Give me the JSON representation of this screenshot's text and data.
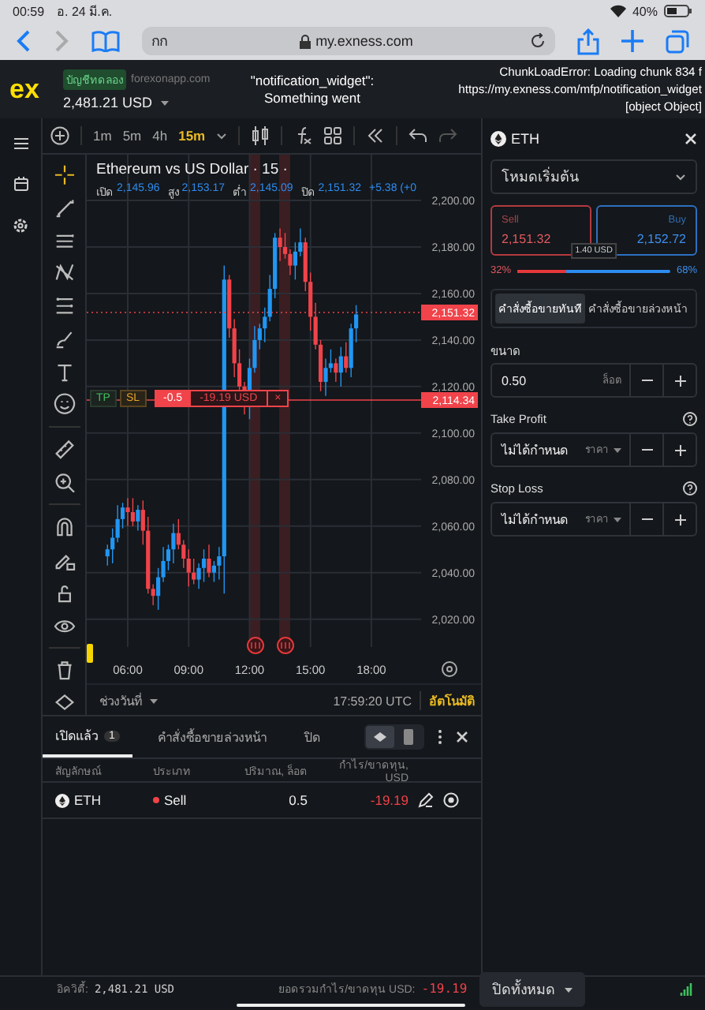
{
  "device_status": {
    "time": "00:59",
    "date": "อ. 24 มี.ค.",
    "battery": "40%"
  },
  "browser": {
    "text_size_button": "กก",
    "url": "my.exness.com"
  },
  "app_header": {
    "logo": "ex",
    "account_badge": "บัญชีทดลอง",
    "site": "forexonapp.com",
    "balance": "2,481.21 USD",
    "error_messages": [
      {
        "lines": [
          "\"notification_widget\":",
          "Something went"
        ]
      },
      {
        "lines": [
          "ChunkLoadError: Loading chunk 834 f",
          "https://my.exness.com/mfp/notification_widget",
          "[object Object]"
        ]
      }
    ]
  },
  "chart_toolbar": {
    "timeframes": [
      {
        "label": "1m",
        "selected": false
      },
      {
        "label": "5m",
        "selected": false
      },
      {
        "label": "4h",
        "selected": false
      },
      {
        "label": "15m",
        "selected": true
      }
    ]
  },
  "chart": {
    "title": "Ethereum vs US Dollar · 15 ·",
    "ohlc": [
      {
        "label": "เปิด",
        "value": "2,145.96"
      },
      {
        "label": "สูง",
        "value": "2,153.17"
      },
      {
        "label": "ต่ำ",
        "value": "2,145.09"
      },
      {
        "label": "ปิด",
        "value": "2,151.32"
      }
    ],
    "change": "+5.38 (+0",
    "chart_data": {
      "type": "candlestick",
      "xlim": [
        3.98,
        20.45
      ],
      "ylim": [
        2008,
        2219.7
      ],
      "grid": true,
      "x": [
        5,
        5.25,
        5.5,
        5.75,
        6,
        6.25,
        6.5,
        6.75,
        7,
        7.25,
        7.5,
        7.75,
        8,
        8.25,
        8.5,
        8.75,
        9,
        9.25,
        9.5,
        9.75,
        10,
        10.25,
        10.5,
        10.75,
        11,
        11.25,
        11.5,
        11.75,
        12,
        12.25,
        12.5,
        12.75,
        13,
        13.25,
        13.5,
        13.75,
        14,
        14.25,
        14.5,
        14.75,
        15,
        15.25,
        15.5,
        15.75,
        16,
        16.25,
        16.5,
        16.75,
        17,
        17.25
      ],
      "xticks": [
        {
          "value": 6,
          "label": "06:00"
        },
        {
          "value": 9,
          "label": "09:00"
        },
        {
          "value": 12,
          "label": "12:00"
        },
        {
          "value": 15,
          "label": "15:00"
        },
        {
          "value": 18,
          "label": "18:00"
        }
      ],
      "yticks": [
        {
          "value": 2200,
          "label": "2,200.00"
        },
        {
          "value": 2180,
          "label": "2,180.00"
        },
        {
          "value": 2160,
          "label": "2,160.00"
        },
        {
          "value": 2140,
          "label": "2,140.00"
        },
        {
          "value": 2120,
          "label": "2,120.00"
        },
        {
          "value": 2100,
          "label": "2,100.00"
        },
        {
          "value": 2080,
          "label": "2,080.00"
        },
        {
          "value": 2060,
          "label": "2,060.00"
        },
        {
          "value": 2040,
          "label": "2,040.00"
        },
        {
          "value": 2020,
          "label": "2,020.00"
        }
      ],
      "ohlc": [
        [
          2047,
          2052,
          2043,
          2050
        ],
        [
          2050,
          2059,
          2044,
          2055
        ],
        [
          2055,
          2069,
          2053,
          2063
        ],
        [
          2063,
          2070,
          2059,
          2068
        ],
        [
          2068,
          2072,
          2060,
          2066
        ],
        [
          2066,
          2072,
          2060,
          2062
        ],
        [
          2062,
          2069,
          2058,
          2067
        ],
        [
          2067,
          2071,
          2052,
          2058
        ],
        [
          2058,
          2064,
          2031,
          2033
        ],
        [
          2033,
          2035,
          2026,
          2030
        ],
        [
          2030,
          2042,
          2024,
          2038
        ],
        [
          2038,
          2051,
          2036,
          2045
        ],
        [
          2045,
          2052,
          2041,
          2050
        ],
        [
          2050,
          2061,
          2044,
          2057
        ],
        [
          2057,
          2063,
          2050,
          2052
        ],
        [
          2052,
          2054,
          2042,
          2046
        ],
        [
          2046,
          2050,
          2034,
          2040
        ],
        [
          2040,
          2046,
          2035,
          2037
        ],
        [
          2037,
          2044,
          2033,
          2042
        ],
        [
          2042,
          2050,
          2036,
          2046
        ],
        [
          2046,
          2052,
          2038,
          2040
        ],
        [
          2040,
          2045,
          2036,
          2043
        ],
        [
          2043,
          2051,
          2037,
          2047
        ],
        [
          2047,
          2172,
          2031,
          2166
        ],
        [
          2166,
          2168,
          2141,
          2145
        ],
        [
          2145,
          2149,
          2124,
          2130
        ],
        [
          2130,
          2136,
          2118,
          2120
        ],
        [
          2120,
          2122,
          2108,
          2112
        ],
        [
          2112,
          2132,
          2106,
          2128
        ],
        [
          2128,
          2146,
          2126,
          2140
        ],
        [
          2140,
          2147,
          2136,
          2145
        ],
        [
          2145,
          2154,
          2139,
          2150
        ],
        [
          2150,
          2168,
          2148,
          2162
        ],
        [
          2162,
          2186,
          2158,
          2184
        ],
        [
          2184,
          2188,
          2174,
          2180
        ],
        [
          2180,
          2186,
          2175,
          2177
        ],
        [
          2177,
          2179,
          2168,
          2172
        ],
        [
          2172,
          2182,
          2166,
          2178
        ],
        [
          2178,
          2188,
          2176,
          2182
        ],
        [
          2182,
          2184,
          2161,
          2165
        ],
        [
          2165,
          2169,
          2144,
          2150
        ],
        [
          2150,
          2156,
          2136,
          2138
        ],
        [
          2138,
          2140,
          2118,
          2122
        ],
        [
          2122,
          2132,
          2116,
          2128
        ],
        [
          2128,
          2136,
          2126,
          2130
        ],
        [
          2130,
          2132,
          2122,
          2126
        ],
        [
          2126,
          2137,
          2120,
          2133
        ],
        [
          2133,
          2139,
          2126,
          2128
        ],
        [
          2128,
          2147,
          2124,
          2145
        ],
        [
          2145,
          2155,
          2139,
          2151
        ]
      ]
    },
    "current_price": "2,151.32",
    "position_price": "2,114.34",
    "position_line": {
      "tp": "TP",
      "sl": "SL",
      "volume": "-0.5",
      "profit": "-19.19 USD",
      "close": "×"
    },
    "date_range": "ช่วงวันที่",
    "clock": "17:59:20 UTC",
    "scale_mode": "อัตโนมัติ"
  },
  "order_panel": {
    "symbol": "ETH",
    "mode": "โหมดเริ่มต้น",
    "sell": {
      "label": "Sell",
      "price": "2,151.32"
    },
    "buy": {
      "label": "Buy",
      "price": "2,152.72"
    },
    "spread": "1.40 USD",
    "sell_share": "32%",
    "buy_share": "68%",
    "sentiment": {
      "level": 0.32
    },
    "order_tabs": [
      {
        "label": "คำสั่งซื้อขายทันที",
        "selected": true
      },
      {
        "label": "คำสั่งซื้อขายล่วงหน้า",
        "selected": false
      }
    ],
    "fields": [
      {
        "label": "ขนาด",
        "value": "0.50",
        "unit": "ล็อต",
        "unit_dropdown": false,
        "help": false
      },
      {
        "label": "Take Profit",
        "value": "ไม่ได้กำหนด",
        "unit": "ราคา",
        "unit_dropdown": true,
        "help": true
      },
      {
        "label": "Stop Loss",
        "value": "ไม่ได้กำหนด",
        "unit": "ราคา",
        "unit_dropdown": true,
        "help": true
      }
    ]
  },
  "positions": {
    "tabs": [
      {
        "label": "เปิดแล้ว",
        "count": "1",
        "selected": true
      },
      {
        "label": "คำสั่งซื้อขายล่วงหน้า",
        "selected": false
      },
      {
        "label": "ปิด",
        "selected": false
      }
    ],
    "columns": [
      "สัญลักษณ์",
      "ประเภท",
      "ปริมาณ, ล็อต",
      "กำไร/ขาดทุน, USD"
    ],
    "rows": [
      {
        "symbol": "ETH",
        "type": "Sell",
        "volume": "0.5",
        "profit": "-19.19"
      }
    ]
  },
  "footer": {
    "equity_label": "อิควิตี้:",
    "equity": "2,481.21 USD",
    "total_label": "ยอดรวมกำไร/ขาดทุน USD:",
    "total": "-19.19",
    "close_all": "ปิดทั้งหมด"
  }
}
